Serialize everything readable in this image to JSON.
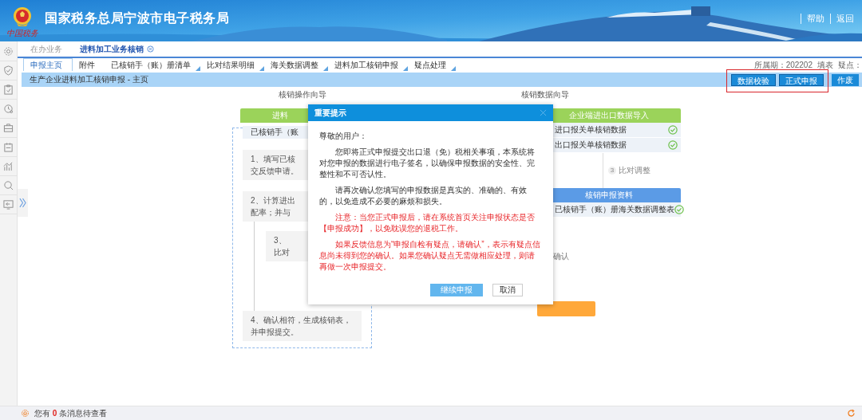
{
  "header": {
    "title": "国家税务总局宁波市电子税务局",
    "logo_caption": "中国税务",
    "links": [
      "帮助",
      "返回"
    ]
  },
  "page_tabs": [
    {
      "label": "在办业务",
      "selected": false,
      "closable": false
    },
    {
      "label": "进料加工业务核销",
      "selected": true,
      "closable": true
    }
  ],
  "sub_tabs": [
    {
      "label": "申报主页",
      "selected": true,
      "marked": false
    },
    {
      "label": "附件",
      "selected": false,
      "marked": false
    },
    {
      "label": "已核销手（账）册清单",
      "selected": false,
      "marked": true
    },
    {
      "label": "比对结果明细",
      "selected": false,
      "marked": true
    },
    {
      "label": "海关数据调整",
      "selected": false,
      "marked": true
    },
    {
      "label": "进料加工核销申报",
      "selected": false,
      "marked": true
    },
    {
      "label": "疑点处理",
      "selected": false,
      "marked": true
    }
  ],
  "period_info": [
    "所属期：202202",
    "填表",
    "疑点："
  ],
  "page_title": "生产企业进料加工核销申报 - 主页",
  "actions": [
    {
      "label": "数据校验",
      "highlighted": true
    },
    {
      "label": "正式申报",
      "highlighted": true
    },
    {
      "label": "作废",
      "highlighted": false
    }
  ],
  "operation_guide": {
    "title": "核销操作向导",
    "header": "进料",
    "first_row": "已核销手（账",
    "steps": [
      {
        "kind": "main",
        "lines": [
          "1、填写已核",
          "交反馈申请。"
        ]
      },
      {
        "kind": "main",
        "lines": [
          "2、计算进出",
          "配率；并与"
        ]
      },
      {
        "kind": "sub",
        "lines": [
          "3、",
          "比对"
        ]
      },
      {
        "kind": "main",
        "lines": [
          "4、确认相符，生成核销表，并申报提交。"
        ]
      }
    ]
  },
  "data_guide": {
    "title": "核销数据向导",
    "import_header": "企业端进出口数据导入",
    "import_rows": [
      {
        "label": "进口报关单核销数据",
        "done": true
      },
      {
        "label": "出口报关单核销数据",
        "done": true
      }
    ],
    "step_number": "3",
    "step_label": "比对调整",
    "report_header": "核销申报资料",
    "report_rows": [
      {
        "label": "已核销手（账）册海关数据调整表",
        "done": true
      }
    ],
    "confirm_label": "确认"
  },
  "dialog": {
    "title": "重要提示",
    "greeting": "尊敬的用户：",
    "paragraphs": [
      {
        "kind": "normal",
        "text": "您即将正式申报提交出口退（免）税相关事项，本系统将对您申报的数据进行电子签名，以确保申报数据的安全性、完整性和不可否认性。"
      },
      {
        "kind": "normal",
        "text": "请再次确认您填写的申报数据是真实的、准确的、有效的，以免造成不必要的麻烦和损失。"
      },
      {
        "kind": "warning",
        "text": "注意：当您正式申报后，请在系统首页关注申报状态是否【申报成功】，以免耽误您的退税工作。"
      },
      {
        "kind": "warning",
        "text": "如果反馈信息为“申报自检有疑点，请确认”，表示有疑点信息尚未得到您的确认。如果您确认疑点无需做相应处理，则请再做一次申报提交。"
      }
    ],
    "buttons": [
      {
        "label": "继续申报",
        "kind": "primary"
      },
      {
        "label": "取消",
        "kind": "secondary"
      }
    ]
  },
  "status_bar": {
    "message": "您有 **0** 条消息待查看"
  }
}
